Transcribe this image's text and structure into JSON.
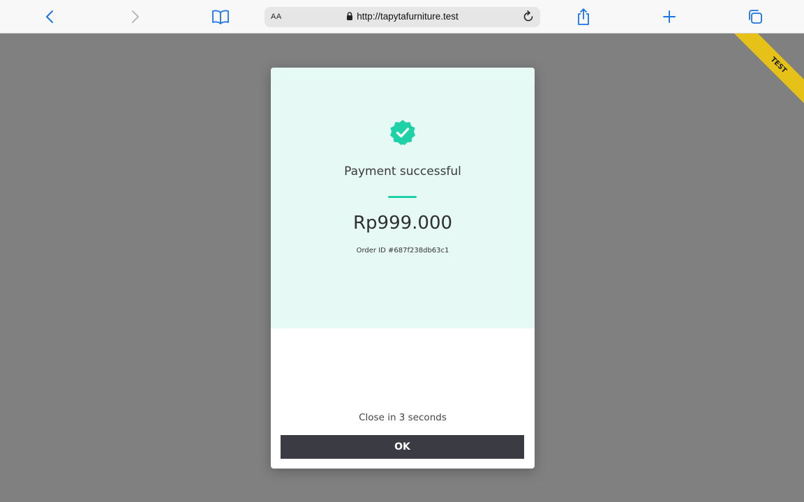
{
  "browser": {
    "reader_label": "AA",
    "url": "http://tapytafurniture.test",
    "accent_color": "#1a73e8"
  },
  "environment": {
    "ribbon_label": "TEST",
    "ribbon_color": "#e6c118"
  },
  "payment": {
    "status_icon": "check-badge-icon",
    "status_color": "#1fd1a6",
    "title": "Payment successful",
    "amount": "Rp999.000",
    "order_id": "Order ID #687f238db63c1",
    "countdown": "Close in 3 seconds",
    "ok_label": "OK"
  }
}
